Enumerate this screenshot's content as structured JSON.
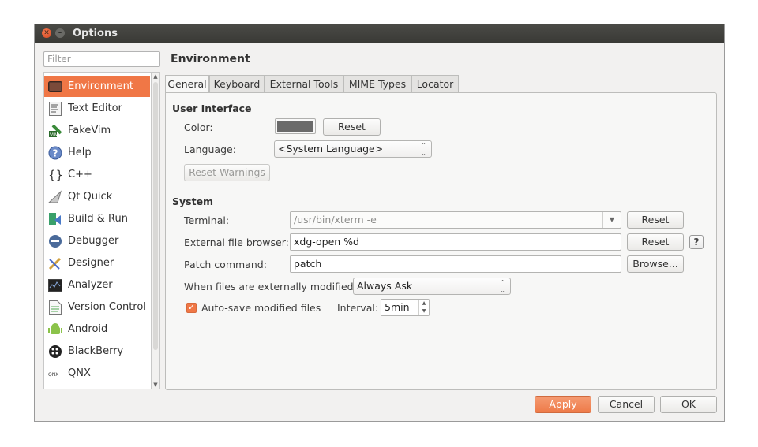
{
  "window": {
    "title": "Options"
  },
  "filter": {
    "placeholder": "Filter"
  },
  "categories": [
    {
      "label": "Environment",
      "icon": "environment-icon",
      "selected": true
    },
    {
      "label": "Text Editor",
      "icon": "text-editor-icon"
    },
    {
      "label": "FakeVim",
      "icon": "fakevim-icon"
    },
    {
      "label": "Help",
      "icon": "help-icon"
    },
    {
      "label": "C++",
      "icon": "cpp-icon"
    },
    {
      "label": "Qt Quick",
      "icon": "qt-quick-icon"
    },
    {
      "label": "Build & Run",
      "icon": "build-run-icon"
    },
    {
      "label": "Debugger",
      "icon": "debugger-icon"
    },
    {
      "label": "Designer",
      "icon": "designer-icon"
    },
    {
      "label": "Analyzer",
      "icon": "analyzer-icon"
    },
    {
      "label": "Version Control",
      "icon": "version-control-icon"
    },
    {
      "label": "Android",
      "icon": "android-icon"
    },
    {
      "label": "BlackBerry",
      "icon": "blackberry-icon"
    },
    {
      "label": "QNX",
      "icon": "qnx-icon"
    }
  ],
  "page": {
    "title": "Environment",
    "tabs": [
      "General",
      "Keyboard",
      "External Tools",
      "MIME Types",
      "Locator"
    ],
    "active_tab": "General",
    "ui_section": {
      "title": "User Interface",
      "color_label": "Color:",
      "color_value": "#6a6a6a",
      "reset_label": "Reset",
      "language_label": "Language:",
      "language_value": "<System Language>",
      "reset_warnings_label": "Reset Warnings"
    },
    "system_section": {
      "title": "System",
      "terminal_label": "Terminal:",
      "terminal_value": "/usr/bin/xterm -e",
      "terminal_reset": "Reset",
      "browser_label": "External file browser:",
      "browser_value": "xdg-open %d",
      "browser_reset": "Reset",
      "help_label": "?",
      "patch_label": "Patch command:",
      "patch_value": "patch",
      "browse_label": "Browse...",
      "modified_label": "When files are externally modified:",
      "modified_value": "Always Ask",
      "autosave_label": "Auto-save modified files",
      "autosave_checked": true,
      "interval_label": "Interval:",
      "interval_value": "5min"
    }
  },
  "footer": {
    "apply": "Apply",
    "cancel": "Cancel",
    "ok": "OK"
  },
  "colors": {
    "accent": "#f07746"
  }
}
